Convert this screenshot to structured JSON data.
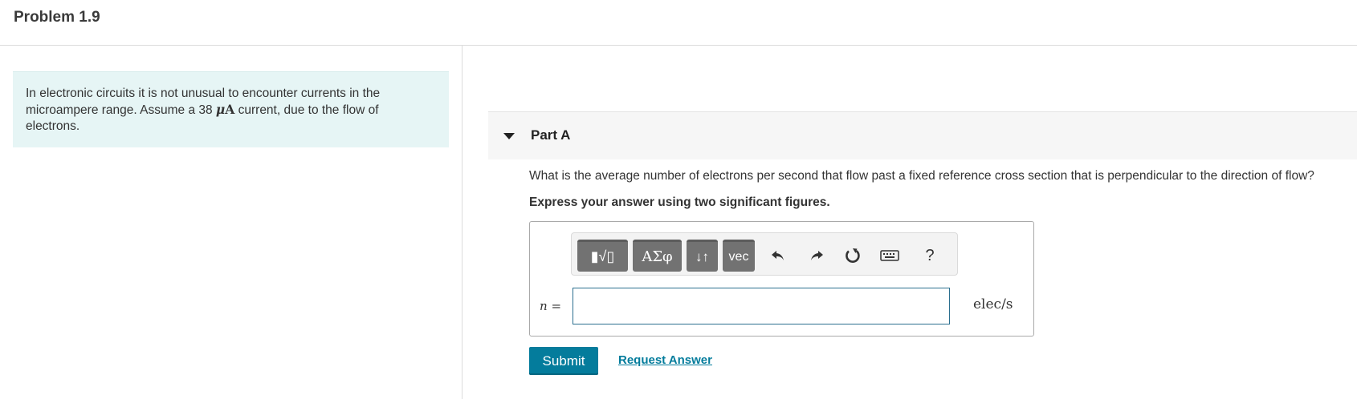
{
  "header": {
    "title": "Problem 1.9"
  },
  "intro": {
    "text_before": "In electronic circuits it is not unusual to encounter currents in the microampere range. Assume a 38 ",
    "math_mu": "μ",
    "math_unit": "A",
    "text_after": " current, due to the flow of electrons."
  },
  "part": {
    "title": "Part A",
    "question": "What is the average number of electrons per second that flow past a fixed reference cross section that is perpendicular to the direction of flow?",
    "instruction": "Express your answer using two significant figures."
  },
  "toolbar": {
    "templates_icon": "templates-icon",
    "templates_label": "▮√▯",
    "greek_label": "ΑΣφ",
    "arrows_label": "↓↑",
    "vec_label": "vec",
    "undo_icon": "undo-icon",
    "redo_icon": "redo-icon",
    "reset_icon": "reset-icon",
    "keyboard_icon": "keyboard-icon",
    "help_label": "?"
  },
  "answer": {
    "variable": "n",
    "equals": " =",
    "value": "",
    "unit": "elec/s"
  },
  "actions": {
    "submit_label": "Submit",
    "request_label": "Request Answer"
  },
  "colors": {
    "accent": "#047c9c",
    "intro_bg": "#e6f5f5",
    "toolbar_button": "#727272"
  }
}
